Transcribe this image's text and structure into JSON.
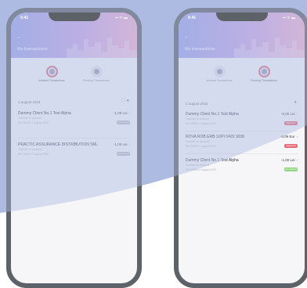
{
  "colors": {
    "background_blue": "#aebbe2",
    "phone_frame": "#5d6168",
    "header_gradient_start": "#9aa6e8",
    "header_gradient_end": "#f0b2d0",
    "accent_red": "#e46b7c",
    "badge_green": "#8fd67e",
    "badge_gray": "#b9bcc4"
  },
  "phones": [
    {
      "status": {
        "time": "9:41",
        "icons": "▪▪ ᯤ ▬"
      },
      "header": {
        "back_icon": "arrow-left-icon",
        "title": "My transactions"
      },
      "tabs": [
        {
          "label": "Initiated Transactions",
          "active": true
        },
        {
          "label": "Pending Transactions",
          "active": false
        }
      ],
      "date": "4 august 2022",
      "list_icons": "⛶ ●",
      "transactions": [
        {
          "name": "Dummy Client No.1 Test Alpha",
          "sub": "Transfer to account",
          "meta": "Ref 00000  4 august 2022",
          "amount": "-1,00 Lei",
          "badge": "Processed",
          "badge_color": "gray"
        },
        {
          "name": "PRACTIC ASSURANCE DISTRIBUTION SRL",
          "sub": "Transfer to account",
          "meta": "Ref 00000  4 august 2022",
          "amount": "-1,00 Lei",
          "badge": "Processed",
          "badge_color": "gray"
        }
      ]
    },
    {
      "status": {
        "time": "9:41",
        "icons": "▪▪ ᯤ ▬"
      },
      "header": {
        "back_icon": "arrow-left-icon",
        "title": "My transactions"
      },
      "tabs": [
        {
          "label": "Initiated Transactions",
          "active": false
        },
        {
          "label": "Pending Transactions",
          "active": true
        }
      ],
      "date": "4 august 2022",
      "list_icons": "●",
      "transactions": [
        {
          "name": "Dummy Client No.1 Test Alpha",
          "sub": "Transfer to account",
          "meta": "Ref 00000  4 august 2022",
          "amount": "-5,00 Lei",
          "badge": "Rejected",
          "badge_color": "red"
        },
        {
          "name": "ROVA ROB ERB 1UPI 0420 3038",
          "sub": "Transfer to account",
          "meta": "Ref 00000  4 august 2022",
          "amount": "-0,09 Eur",
          "badge": "Rejected",
          "badge_color": "red"
        },
        {
          "name": "Dummy Client No.1 Test Alpha",
          "sub": "Transfer to account",
          "meta": "Ref 00000  4 august 2022",
          "amount": "-1,00 Lei",
          "badge": "Completed",
          "badge_color": "green"
        }
      ]
    }
  ]
}
